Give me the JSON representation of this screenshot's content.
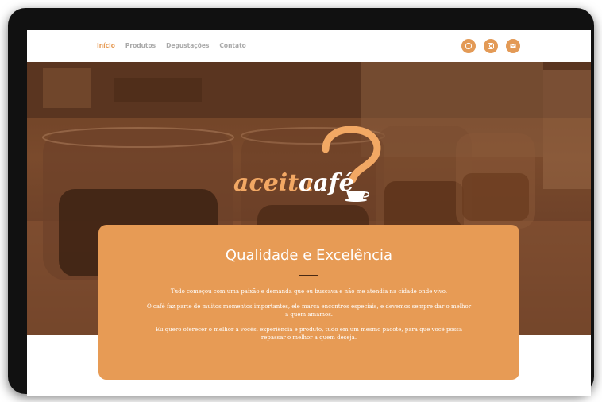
{
  "nav": {
    "items": [
      {
        "label": "Início",
        "active": true
      },
      {
        "label": "Produtos",
        "active": false
      },
      {
        "label": "Degustações",
        "active": false
      },
      {
        "label": "Contato",
        "active": false
      }
    ]
  },
  "social": {
    "icons": [
      "whatsapp-icon",
      "instagram-icon",
      "email-icon"
    ]
  },
  "hero": {
    "logo_text": "aceitacafé",
    "logo_mark": "®"
  },
  "card": {
    "title": "Qualidade e Excelência",
    "paragraphs": [
      "Tudo começou com uma paixão e demanda que eu buscava e não me atendia na cidade onde vivo.",
      "O café faz parte de muitos momentos importantes, ele marca encontros especiais, e devemos sempre dar o melhor a quem amamos.",
      "Eu quero oferecer o melhor a vocês, experiência e produto, tudo em um mesmo pacote, para que você possa repassar o melhor a quem deseja."
    ]
  },
  "colors": {
    "accent": "#e69b55",
    "card_bg": "#e79b55",
    "nav_text": "#a9a9a9",
    "hero_tint": "#6a3f24"
  }
}
